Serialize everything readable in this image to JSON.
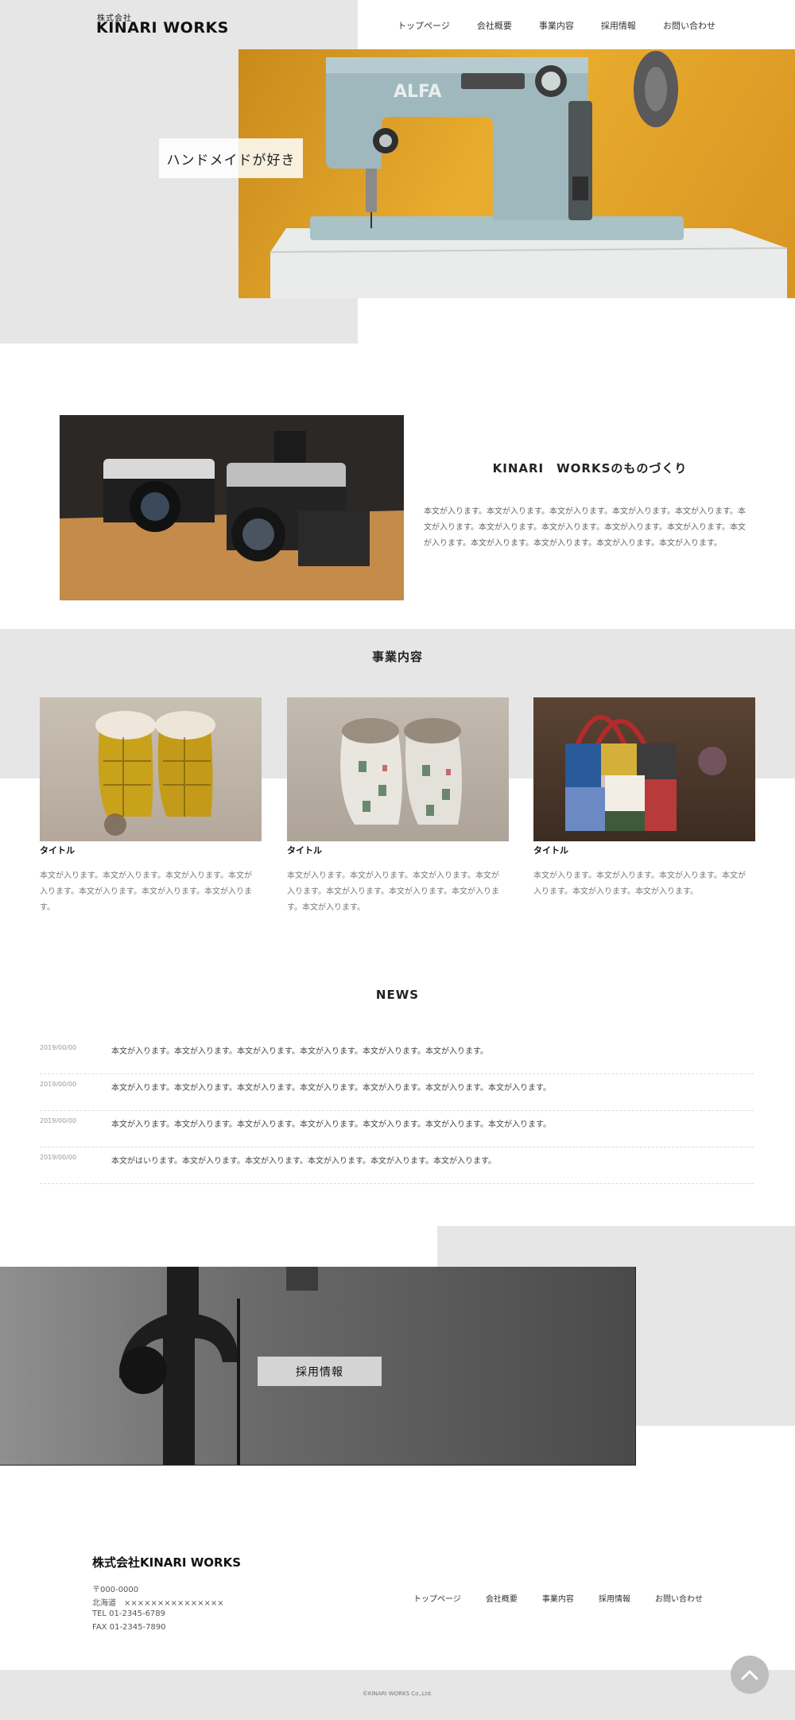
{
  "header": {
    "logo_small": "株式会社",
    "logo_main": "KINARI WORKS",
    "nav": [
      "トップページ",
      "会社概要",
      "事業内容",
      "採用情報",
      "お問い合わせ"
    ]
  },
  "hero": {
    "title": "ハンドメイドが好き",
    "machine_logo": "ALFA"
  },
  "about": {
    "heading": "KINARI　WORKSのものづくり",
    "lines": [
      "本文が入ります。本文が入ります。本文が入ります。本文が入ります。本文が入ります。本",
      "文が入ります。本文が入ります。本文が入ります。本文が入ります。本文が入ります。本文",
      "が入ります。本文が入ります。本文が入ります。本文が入ります。本文が入ります。"
    ]
  },
  "business": {
    "heading": "事業内容",
    "cards": [
      {
        "title": "タイトル",
        "lines": [
          "本文が入ります。本文が入ります。本文が入ります。本文が",
          "入ります。本文が入ります。本文が入ります。本文が入りま",
          "す。"
        ]
      },
      {
        "title": "タイトル",
        "lines": [
          "本文が入ります。本文が入ります。本文が入ります。本文が",
          "入ります。本文が入ります。本文が入ります。本文が入りま",
          "す。本文が入ります。"
        ]
      },
      {
        "title": "タイトル",
        "lines": [
          "本文が入ります。本文が入ります。本文が入ります。本文が",
          "入ります。本文が入ります。本文が入ります。"
        ]
      }
    ]
  },
  "news": {
    "heading": "NEWS",
    "items": [
      {
        "date": "2019/00/00",
        "text": "本文が入ります。本文が入ります。本文が入ります。本文が入ります。本文が入ります。本文が入ります。"
      },
      {
        "date": "2019/00/00",
        "text": "本文が入ります。本文が入ります。本文が入ります。本文が入ります。本文が入ります。本文が入ります。本文が入ります。"
      },
      {
        "date": "2019/00/00",
        "text": "本文が入ります。本文が入ります。本文が入ります。本文が入ります。本文が入ります。本文が入ります。本文が入ります。"
      },
      {
        "date": "2019/00/00",
        "text": "本文がはいります。本文が入ります。本文が入ります。本文が入ります。本文が入ります。本文が入ります。"
      }
    ]
  },
  "recruit": {
    "label": "採用情報"
  },
  "footer": {
    "company": "株式会社KINARI WORKS",
    "address": [
      "〒000-0000",
      "北海道　×××××××××××××××",
      "TEL 01-2345-6789",
      "FAX 01-2345-7890"
    ],
    "nav": [
      "トップページ",
      "会社概要",
      "事業内容",
      "採用情報",
      "お問い合わせ"
    ],
    "copyright": "©KINARI WORKS Co.,Ltd."
  },
  "colors": {
    "gray_band": "#e6e6e6",
    "hero_wall": "#e0a32a",
    "machine": "#9fb8bd"
  }
}
